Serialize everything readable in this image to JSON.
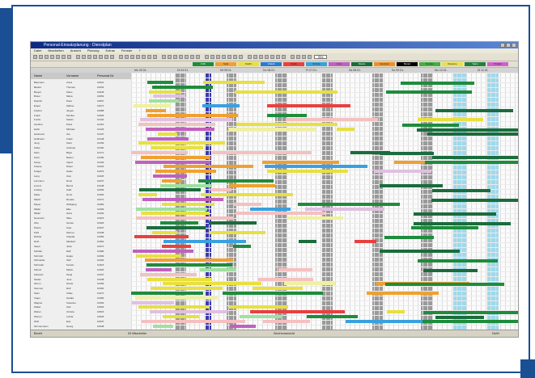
{
  "window": {
    "title": "Personal-Einsatzplanung - Dienstplan"
  },
  "menu": [
    "Datei",
    "Bearbeiten",
    "Ansicht",
    "Planung",
    "Extras",
    "Fenster",
    "?"
  ],
  "toolbar": {
    "zoom": "75%"
  },
  "legend": [
    {
      "label": "Früh",
      "color": "#1e8c3c"
    },
    {
      "label": "Spät",
      "color": "#f0a030"
    },
    {
      "label": "Nacht",
      "color": "#e8e040"
    },
    {
      "label": "Urlaub",
      "color": "#2a7ad0"
    },
    {
      "label": "Krank",
      "color": "#e84040"
    },
    {
      "label": "Schule",
      "color": "#3aa0e0"
    },
    {
      "label": "Frei",
      "color": "#c060c0"
    },
    {
      "label": "Dienst",
      "color": "#1a6c3c"
    },
    {
      "label": "Seminar",
      "color": "#f09020"
    },
    {
      "label": "Bereit",
      "color": "#000000"
    },
    {
      "label": "Sonder",
      "color": "#40b040"
    },
    {
      "label": "Reserve",
      "color": "#e8e050"
    },
    {
      "label": "Team",
      "color": "#208040"
    },
    {
      "label": "Projekt",
      "color": "#d060d0"
    }
  ],
  "dates": [
    "Mo 03.01.",
    "Di 04.01.",
    "Mi 05.01.",
    "Do 06.01.",
    "Fr 07.01.",
    "Sa 08.01.",
    "So 09.01.",
    "Mo 10.01.",
    "Di 11.01."
  ],
  "columns": {
    "name": "Name",
    "first": "Vorname",
    "id": "Personal-Nr."
  },
  "employees": [
    {
      "name": "Baumann",
      "first": "Anna",
      "id": "10021"
    },
    {
      "name": "Becker",
      "first": "Thomas",
      "id": "10034"
    },
    {
      "name": "Berger",
      "first": "Klaus",
      "id": "10045"
    },
    {
      "name": "Braun",
      "first": "Maria",
      "id": "10052"
    },
    {
      "name": "Dietrich",
      "first": "Peter",
      "id": "10067"
    },
    {
      "name": "Engel",
      "first": "Sabine",
      "id": "10071"
    },
    {
      "name": "Fischer",
      "first": "Jürgen",
      "id": "10088"
    },
    {
      "name": "Frank",
      "first": "Monika",
      "id": "10093"
    },
    {
      "name": "Fuchs",
      "first": "Stefan",
      "id": "10104"
    },
    {
      "name": "Günther",
      "first": "Petra",
      "id": "10115"
    },
    {
      "name": "Hahn",
      "first": "Michael",
      "id": "10126"
    },
    {
      "name": "Hartmann",
      "first": "Ute",
      "id": "10137"
    },
    {
      "name": "Hoffmann",
      "first": "Frank",
      "id": "10148"
    },
    {
      "name": "Jung",
      "first": "Karin",
      "id": "10159"
    },
    {
      "name": "Keller",
      "first": "Andreas",
      "id": "10160"
    },
    {
      "name": "Klein",
      "first": "Birgit",
      "id": "10171"
    },
    {
      "name": "Koch",
      "first": "Rainer",
      "id": "10182"
    },
    {
      "name": "König",
      "first": "Ingrid",
      "id": "10193"
    },
    {
      "name": "Krause",
      "first": "Dieter",
      "id": "10204"
    },
    {
      "name": "Krüger",
      "first": "Heike",
      "id": "10215"
    },
    {
      "name": "Lang",
      "first": "Uwe",
      "id": "10226"
    },
    {
      "name": "Lehmann",
      "first": "Doris",
      "id": "10237"
    },
    {
      "name": "Lorenz",
      "first": "Bernd",
      "id": "10248"
    },
    {
      "name": "Ludwig",
      "first": "Gabi",
      "id": "10259"
    },
    {
      "name": "Maier",
      "first": "Horst",
      "id": "10260"
    },
    {
      "name": "Martin",
      "first": "Renate",
      "id": "10271"
    },
    {
      "name": "Meyer",
      "first": "Wolfgang",
      "id": "10282"
    },
    {
      "name": "Möller",
      "first": "Elke",
      "id": "10293"
    },
    {
      "name": "Müller",
      "first": "Hans",
      "id": "10304"
    },
    {
      "name": "Neumann",
      "first": "Silke",
      "id": "10315"
    },
    {
      "name": "Otto",
      "first": "Günter",
      "id": "10326"
    },
    {
      "name": "Peters",
      "first": "Anja",
      "id": "10337"
    },
    {
      "name": "Pohl",
      "first": "Werner",
      "id": "10348"
    },
    {
      "name": "Richter",
      "first": "Claudia",
      "id": "10359"
    },
    {
      "name": "Roth",
      "first": "Manfred",
      "id": "10360"
    },
    {
      "name": "Sauer",
      "first": "Jutta",
      "id": "10371"
    },
    {
      "name": "Schäfer",
      "first": "Ralf",
      "id": "10382"
    },
    {
      "name": "Schmidt",
      "first": "Helga",
      "id": "10393"
    },
    {
      "name": "Schneider",
      "first": "Olaf",
      "id": "10404"
    },
    {
      "name": "Schröder",
      "first": "Kerstin",
      "id": "10415"
    },
    {
      "name": "Schulz",
      "first": "Martin",
      "id": "10426"
    },
    {
      "name": "Schwarz",
      "first": "Tanja",
      "id": "10437"
    },
    {
      "name": "Seidel",
      "first": "Jens",
      "id": "10448"
    },
    {
      "name": "Simon",
      "first": "Nicole",
      "id": "10459"
    },
    {
      "name": "Sommer",
      "first": "Rolf",
      "id": "10460"
    },
    {
      "name": "Stein",
      "first": "Ulrike",
      "id": "10471"
    },
    {
      "name": "Vogel",
      "first": "Harald",
      "id": "10482"
    },
    {
      "name": "Wagner",
      "first": "Susanne",
      "id": "10493"
    },
    {
      "name": "Walter",
      "first": "Karl",
      "id": "10504"
    },
    {
      "name": "Weber",
      "first": "Christa",
      "id": "10515"
    },
    {
      "name": "Werner",
      "first": "Lothar",
      "id": "10526"
    },
    {
      "name": "Wolf",
      "first": "Eva",
      "id": "10537"
    },
    {
      "name": "Zimmermann",
      "first": "Georg",
      "id": "10548"
    }
  ],
  "status": {
    "ready": "Bereit",
    "records": "53 Mitarbeiter",
    "view": "Wochenansicht",
    "numlock": "NUM"
  }
}
